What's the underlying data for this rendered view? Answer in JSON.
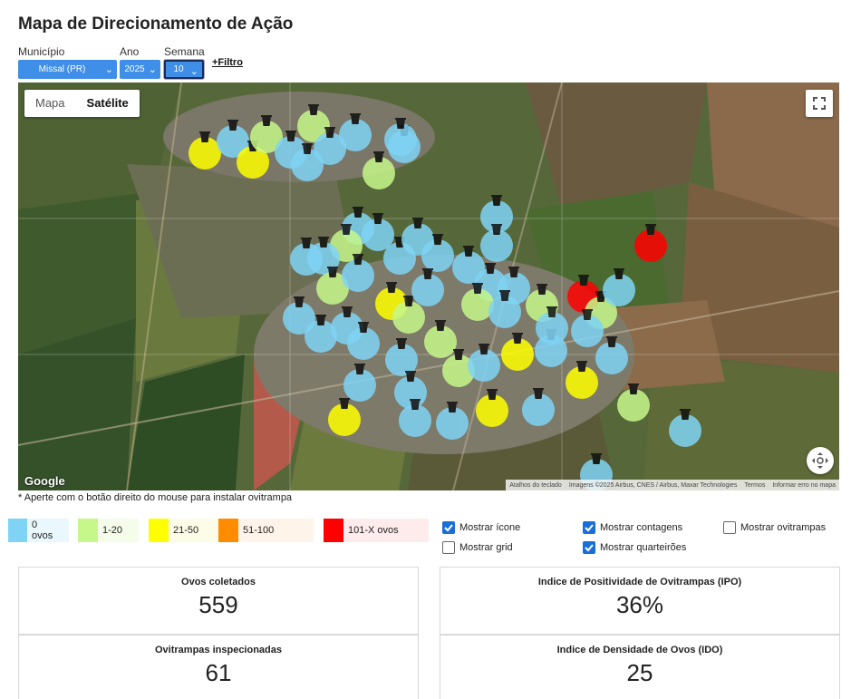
{
  "page": {
    "title": "Mapa de Direcionamento de Ação"
  },
  "filters": {
    "municipio": {
      "label": "Município",
      "value": "Missal (PR)"
    },
    "ano": {
      "label": "Ano",
      "value": "2025"
    },
    "semana": {
      "label": "Semana",
      "value": "10"
    },
    "extra_link": "+Filtro"
  },
  "map": {
    "toggle": {
      "map": "Mapa",
      "satellite": "Satélite"
    },
    "logo": "Google",
    "attribution": [
      "Atalhos do teclado",
      "Imagens ©2025 Airbus, CNES / Airbus, Maxar Technologies",
      "Termos",
      "Informar erro no mapa"
    ]
  },
  "note": "* Aperte com o botão direito do mouse para instalar ovitrampa",
  "legend": [
    {
      "label": "0 ovos",
      "color": "#7fd4f5"
    },
    {
      "label": "1-20",
      "color": "#c6f78a"
    },
    {
      "label": "21-50",
      "color": "#ffff00"
    },
    {
      "label": "51-100",
      "color": "#ff8c00"
    },
    {
      "label": "101-X ovos",
      "color": "#ff0000"
    }
  ],
  "options": {
    "mostrar_icone": {
      "label": "Mostrar ícone",
      "checked": true
    },
    "mostrar_contagens": {
      "label": "Mostrar contagens",
      "checked": true
    },
    "mostrar_ovitrampas": {
      "label": "Mostrar ovitrampas",
      "checked": false
    },
    "mostrar_grid": {
      "label": "Mostrar grid",
      "checked": false
    },
    "mostrar_quarteiroes": {
      "label": "Mostrar quarteirões",
      "checked": true
    }
  },
  "stats": {
    "ovos": {
      "label": "Ovos coletados",
      "value": "559"
    },
    "ipo": {
      "label": "Indice de Positividade de Ovitrampas (IPO)",
      "value": "36%"
    },
    "inspecionadas": {
      "label": "Ovitrampas inspecionadas",
      "value": "61"
    },
    "ido": {
      "label": "Indice de Densidade de Ovos (IDO)",
      "value": "25"
    }
  }
}
